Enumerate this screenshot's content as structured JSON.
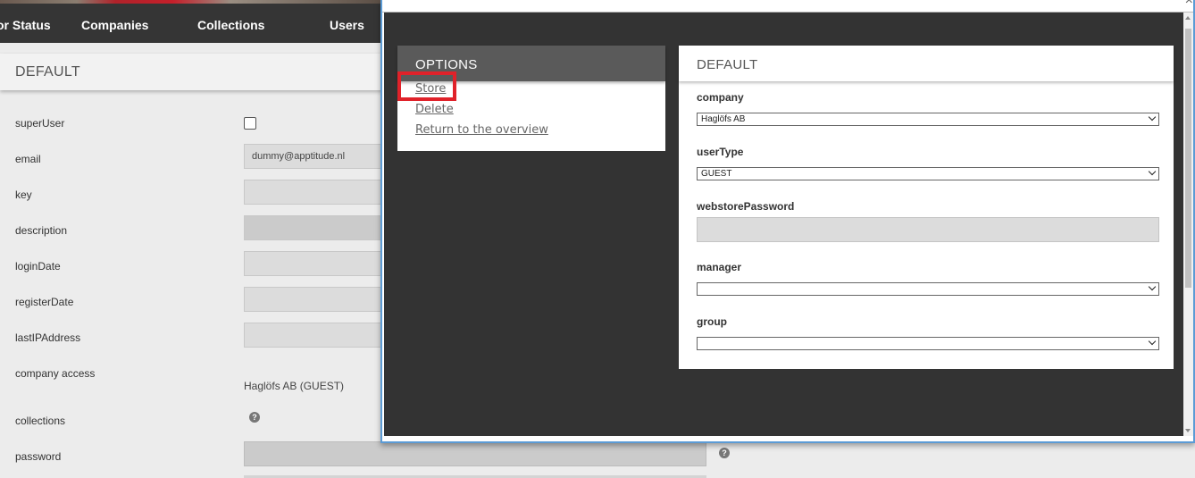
{
  "nav": {
    "items": [
      "or Status",
      "Companies",
      "Collections",
      "Users"
    ]
  },
  "section": {
    "title": "DEFAULT"
  },
  "form": {
    "labels": {
      "superUser": "superUser",
      "email": "email",
      "key": "key",
      "description": "description",
      "loginDate": "loginDate",
      "registerDate": "registerDate",
      "lastIPAddress": "lastIPAddress",
      "company_access": "company access",
      "collections": "collections",
      "password": "password"
    },
    "email_value": "dummy@apptitude.nl",
    "company_access_value": "Haglöfs AB (GUEST)",
    "help_glyph": "?"
  },
  "modal": {
    "options": {
      "title": "OPTIONS",
      "store": "Store",
      "delete": "Delete",
      "return": "Return to the overview"
    },
    "default_panel": {
      "title": "DEFAULT",
      "company_label": "company",
      "company_value": "Haglöfs AB",
      "userType_label": "userType",
      "userType_value": "GUEST",
      "webstorePassword_label": "webstorePassword",
      "manager_label": "manager",
      "group_label": "group"
    },
    "close_glyph": "×"
  },
  "colors": {
    "nav_bg": "#353535",
    "modal_bg": "#333333",
    "options_header": "#5a5a5a",
    "highlight": "#e0222a",
    "modal_border": "#5b9bd5"
  }
}
